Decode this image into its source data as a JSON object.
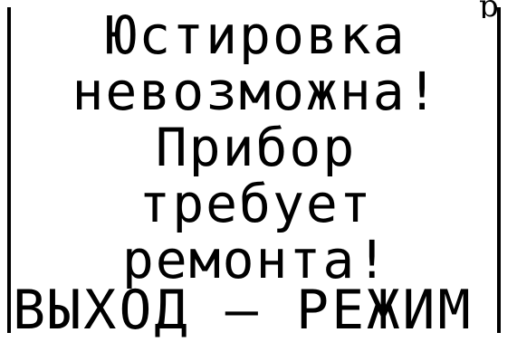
{
  "display": {
    "lines": [
      "Юстировка",
      "невозможна!",
      "Прибор",
      "требует",
      "ремонта!"
    ],
    "footer": "ВЫХОД – РЕЖИМ",
    "top_fragment": "р"
  }
}
